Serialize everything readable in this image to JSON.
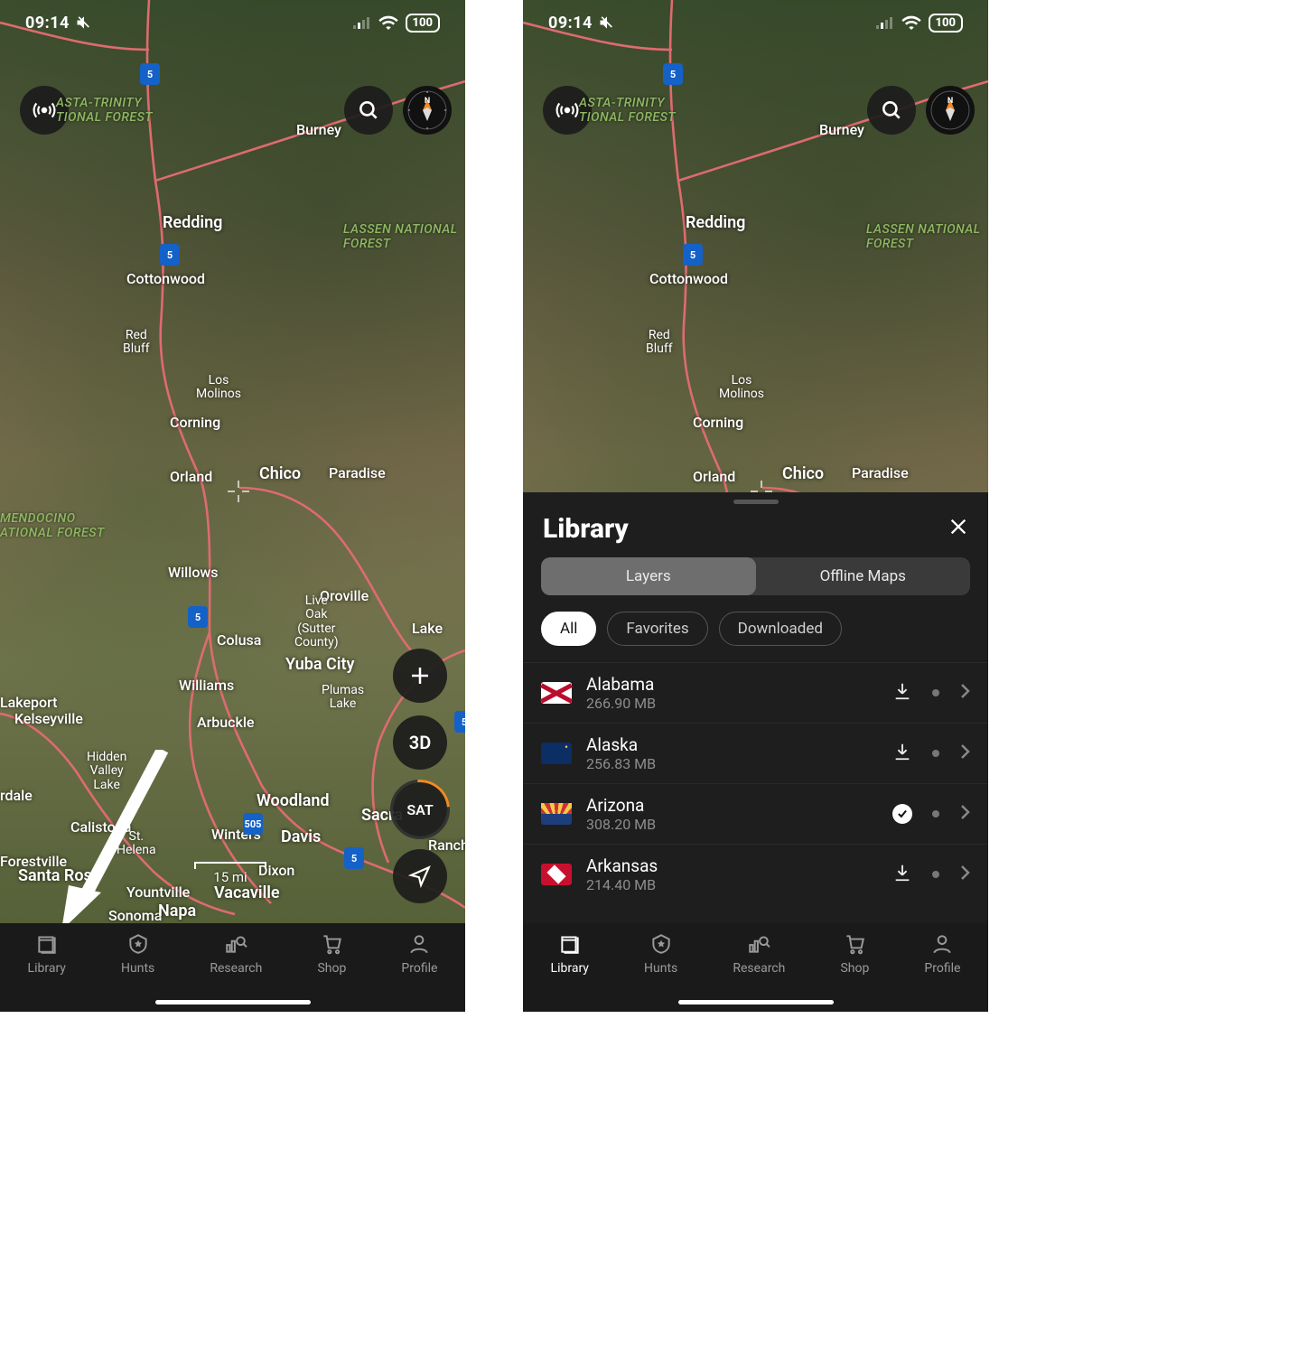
{
  "status": {
    "time": "09:14",
    "battery": "100"
  },
  "forests": [
    {
      "text": "ASTA-TRINITY\nTIONAL FOREST",
      "t": 106,
      "l": 62
    },
    {
      "text": "LASSEN NATIONAL\nFOREST",
      "t": 246,
      "l": 380
    },
    {
      "text": "MENDOCINO\nATIONAL FOREST",
      "t": 566,
      "l": 0
    }
  ],
  "cities": [
    {
      "text": "Burney",
      "t": 134,
      "l": 328
    },
    {
      "text": "Redding",
      "t": 236,
      "l": 180,
      "big": true
    },
    {
      "text": "Cottonwood",
      "t": 299,
      "l": 140
    },
    {
      "text": "Red\nBluff",
      "t": 364,
      "l": 136,
      "sub": true
    },
    {
      "text": "Los\nMolinos",
      "t": 414,
      "l": 217,
      "sub": true
    },
    {
      "text": "Corning",
      "t": 458,
      "l": 188
    },
    {
      "text": "Orland",
      "t": 518,
      "l": 188
    },
    {
      "text": "Chico",
      "t": 514,
      "l": 287,
      "big": true
    },
    {
      "text": "Paradise",
      "t": 514,
      "l": 364
    },
    {
      "text": "Willows",
      "t": 624,
      "l": 186
    },
    {
      "text": "Oroville",
      "t": 650,
      "l": 354
    },
    {
      "text": "Live\nOak\n(Sutter\nCounty)",
      "t": 658,
      "l": 326,
      "sub": true
    },
    {
      "text": "Colusa",
      "t": 699,
      "l": 240
    },
    {
      "text": "Lake",
      "t": 686,
      "l": 456
    },
    {
      "text": "Yuba City",
      "t": 725,
      "l": 316,
      "big": true
    },
    {
      "text": "Plumas\nLake",
      "t": 757,
      "l": 356,
      "sub": true
    },
    {
      "text": "Williams",
      "t": 749,
      "l": 198
    },
    {
      "text": "Lakeport",
      "t": 768,
      "l": 0
    },
    {
      "text": "Kelseyville",
      "t": 786,
      "l": 16
    },
    {
      "text": "Arbuckle",
      "t": 790,
      "l": 218
    },
    {
      "text": "Hidden\nValley\nLake",
      "t": 831,
      "l": 96,
      "sub": true
    },
    {
      "text": "rdale",
      "t": 871,
      "l": 0
    },
    {
      "text": "Woodland",
      "t": 876,
      "l": 284,
      "big": true
    },
    {
      "text": "Sacra",
      "t": 892,
      "l": 400,
      "big": true
    },
    {
      "text": "Calistoga",
      "t": 906,
      "l": 78
    },
    {
      "text": "Winters",
      "t": 914,
      "l": 234
    },
    {
      "text": "Davis",
      "t": 916,
      "l": 311,
      "big": true
    },
    {
      "text": "St.\nHelena",
      "t": 919,
      "l": 129,
      "sub": true
    },
    {
      "text": "Forestville",
      "t": 944,
      "l": 0
    },
    {
      "text": "Dixon",
      "t": 954,
      "l": 286
    },
    {
      "text": "Ranch",
      "t": 926,
      "l": 474
    },
    {
      "text": "Santa Ros",
      "t": 959,
      "l": 20,
      "big": true
    },
    {
      "text": "Yountville",
      "t": 978,
      "l": 140
    },
    {
      "text": "Vacaville",
      "t": 978,
      "l": 237,
      "big": true
    },
    {
      "text": "Sonoma",
      "t": 1004,
      "l": 120
    },
    {
      "text": "Napa",
      "t": 998,
      "l": 175,
      "big": true
    }
  ],
  "shields": [
    {
      "text": "5",
      "t": 70,
      "l": 155
    },
    {
      "text": "5",
      "t": 270,
      "l": 177
    },
    {
      "text": "5",
      "t": 671,
      "l": 208
    },
    {
      "text": "5",
      "t": 787,
      "l": 503
    },
    {
      "text": "505",
      "t": 900,
      "l": 269
    },
    {
      "text": "5",
      "t": 938,
      "l": 381
    }
  ],
  "scale": "15 mi",
  "buttons": {
    "threeD": "3D",
    "sat": "SAT",
    "plus": "+"
  },
  "crosshair": {
    "t": 530,
    "l": 250
  },
  "nav": [
    {
      "label": "Library",
      "icon": "library"
    },
    {
      "label": "Hunts",
      "icon": "hunts"
    },
    {
      "label": "Research",
      "icon": "research"
    },
    {
      "label": "Shop",
      "icon": "shop"
    },
    {
      "label": "Profile",
      "icon": "profile"
    }
  ],
  "library": {
    "title": "Library",
    "tabs": {
      "layers": "Layers",
      "offline": "Offline Maps"
    },
    "chips": {
      "all": "All",
      "fav": "Favorites",
      "down": "Downloaded"
    },
    "rows": [
      {
        "name": "Alabama",
        "size": "266.90 MB",
        "flag": "al",
        "state": "download"
      },
      {
        "name": "Alaska",
        "size": "256.83 MB",
        "flag": "ak",
        "state": "download"
      },
      {
        "name": "Arizona",
        "size": "308.20 MB",
        "flag": "az",
        "state": "done"
      },
      {
        "name": "Arkansas",
        "size": "214.40 MB",
        "flag": "ar",
        "state": "download"
      }
    ]
  }
}
